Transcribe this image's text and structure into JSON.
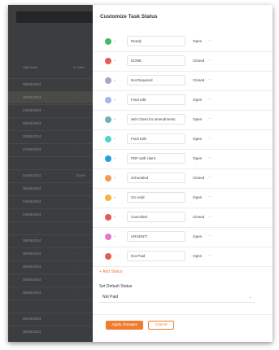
{
  "panel": {
    "title": "Customize Task Status",
    "statuses": [
      {
        "name": "Ready",
        "type": "Open",
        "color": "#45b865"
      },
      {
        "name": "DONE",
        "type": "Closed",
        "color": "#e35d53"
      },
      {
        "name": "Not Required",
        "type": "Closed",
        "color": "#a2a9c4"
      },
      {
        "name": "Final edit",
        "type": "Open",
        "color": "#a9b4ef"
      },
      {
        "name": "with Client for amendments",
        "type": "Open",
        "color": "#6fb1b5"
      },
      {
        "name": "Final Edit",
        "type": "Open",
        "color": "#4fd3cf"
      },
      {
        "name": "PDF with client",
        "type": "Open",
        "color": "#22a0de"
      },
      {
        "name": "Scheduled",
        "type": "Closed",
        "color": "#f39a55"
      },
      {
        "name": "On Hold",
        "type": "Open",
        "color": "#f2b43b"
      },
      {
        "name": "Cancelled",
        "type": "Closed",
        "color": "#e45b52"
      },
      {
        "name": "URGENT!",
        "type": "Open",
        "color": "#e874c7"
      },
      {
        "name": "Not Paid",
        "type": "Open",
        "color": "#e25d53"
      }
    ],
    "add_status_label": "+ Add Status",
    "default_status_label": "Set Default Status",
    "default_status_value": "Not Paid",
    "apply_label": "Apply changes",
    "cancel_label": "Cancel"
  },
  "background": {
    "header_labels": [
      "Start Date",
      "D. Date"
    ],
    "rows": [
      {
        "date": "09/05/2024",
        "extra": ""
      },
      {
        "date": "28/05/2024",
        "extra": "-"
      },
      {
        "date": "24/05/2024",
        "extra": ""
      },
      {
        "date": "09/05/2024",
        "extra": ""
      },
      {
        "date": "20/05/2024",
        "extra": "-"
      },
      {
        "date": "22/05/2024",
        "extra": "-"
      },
      {
        "date": "",
        "extra": ""
      },
      {
        "date": "04/05/2024",
        "extra": "Event"
      },
      {
        "date": "05/05/2024",
        "extra": ""
      },
      {
        "date": "03/05/2024",
        "extra": ""
      },
      {
        "date": "03/05/2024",
        "extra": "-"
      },
      {
        "date": "",
        "extra": ""
      },
      {
        "date": "06/05/2024",
        "extra": ""
      },
      {
        "date": "06/05/2024",
        "extra": "-"
      },
      {
        "date": "06/05/2024",
        "extra": "-"
      },
      {
        "date": "06/05/2024",
        "extra": ""
      },
      {
        "date": "06/05/2024",
        "extra": "-"
      },
      {
        "date": "",
        "extra": ""
      },
      {
        "date": "06/05/2024",
        "extra": ""
      },
      {
        "date": "06/05/2024",
        "extra": ""
      }
    ]
  }
}
